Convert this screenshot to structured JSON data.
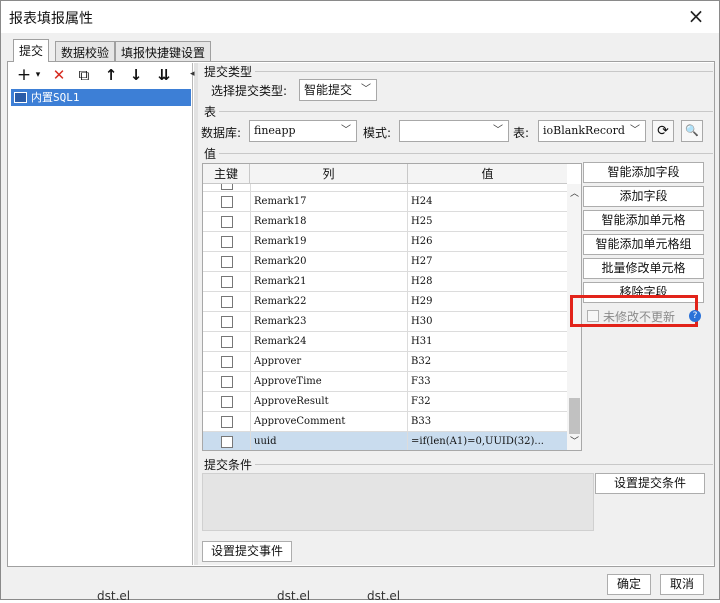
{
  "window": {
    "title": "报表填报属性",
    "close_icon": "×"
  },
  "tabs": [
    {
      "label": "提交",
      "active": true
    },
    {
      "label": "数据校验",
      "active": false
    },
    {
      "label": "填报快捷键设置",
      "active": false
    }
  ],
  "left_toolbar": {
    "add": "+",
    "add_dropdown": "▾",
    "delete": "✕",
    "copy": "⧉",
    "up": "↑",
    "down": "↓",
    "more": "⇊"
  },
  "tree": {
    "item": "内置SQL1"
  },
  "submit_type": {
    "section": "提交类型",
    "label": "选择提交类型:",
    "value": "智能提交"
  },
  "table_section": {
    "section": "表",
    "db_label": "数据库:",
    "db_value": "fineapp",
    "schema_label": "模式:",
    "schema_value": "",
    "table_label": "表:",
    "table_value": "ioBlankRecord",
    "refresh_icon": "⟳",
    "search_icon": "🔍"
  },
  "value_section": {
    "section": "值",
    "headers": {
      "key": "主键",
      "column": "列",
      "value": "值"
    },
    "rows": [
      {
        "column": "Remark17",
        "value": "H24",
        "selected": false
      },
      {
        "column": "Remark18",
        "value": "H25",
        "selected": false
      },
      {
        "column": "Remark19",
        "value": "H26",
        "selected": false
      },
      {
        "column": "Remark20",
        "value": "H27",
        "selected": false
      },
      {
        "column": "Remark21",
        "value": "H28",
        "selected": false
      },
      {
        "column": "Remark22",
        "value": "H29",
        "selected": false
      },
      {
        "column": "Remark23",
        "value": "H30",
        "selected": false
      },
      {
        "column": "Remark24",
        "value": "H31",
        "selected": false
      },
      {
        "column": "Approver",
        "value": "B32",
        "selected": false
      },
      {
        "column": "ApproveTime",
        "value": "F33",
        "selected": false
      },
      {
        "column": "ApproveResult",
        "value": "F32",
        "selected": false
      },
      {
        "column": "ApproveComment",
        "value": "B33",
        "selected": false
      },
      {
        "column": "uuid",
        "value": "=if(len(A1)=0,UUID(32)...",
        "selected": true
      }
    ]
  },
  "side_buttons": {
    "smart_add_field": "智能添加字段",
    "add_field": "添加字段",
    "smart_add_cell": "智能添加单元格",
    "smart_add_cell_group": "智能添加单元格组",
    "batch_modify_cell": "批量修改单元格",
    "remove_field": "移除字段",
    "no_update_unmodified": "未修改不更新"
  },
  "condition": {
    "section": "提交条件",
    "set_button": "设置提交条件"
  },
  "event_button": "设置提交事件",
  "footer": {
    "ok": "确定",
    "cancel": "取消"
  },
  "background_text": [
    "dst.el",
    "dst.el",
    "dst.el"
  ],
  "colors": {
    "selection": "#3d7fd6",
    "highlight_border": "#e2231a",
    "help": "#2b72d8"
  }
}
